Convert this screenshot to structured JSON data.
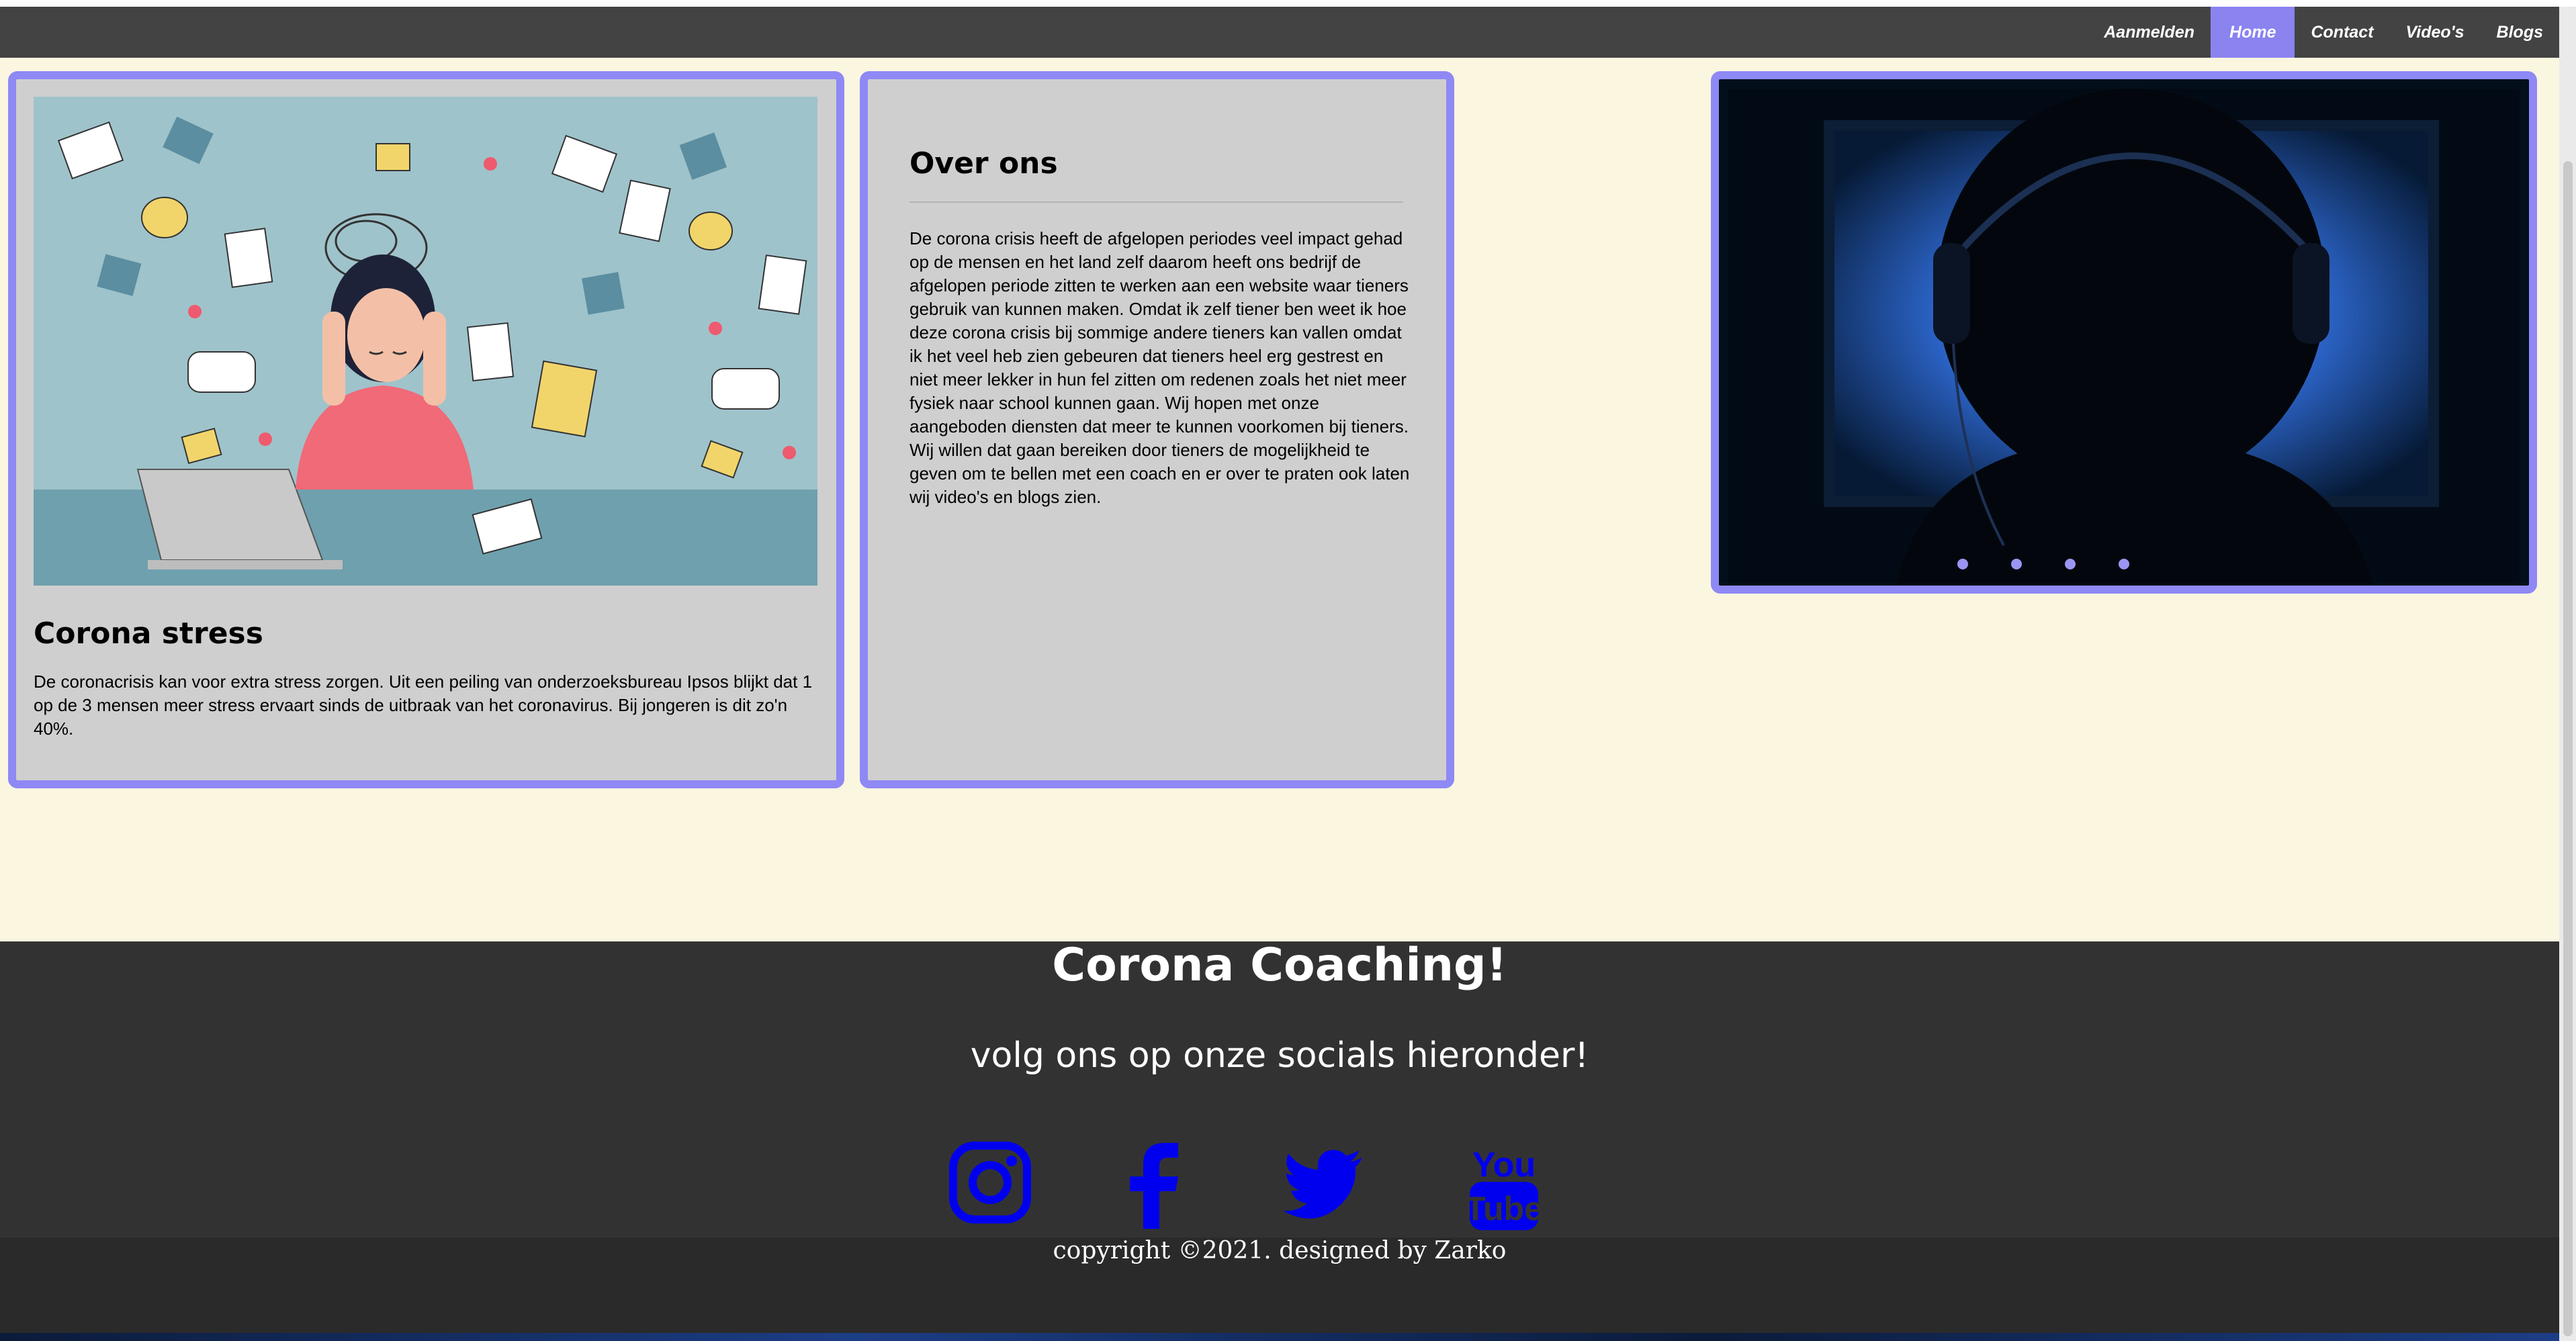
{
  "nav": {
    "items": [
      {
        "label": "Aanmelden",
        "active": false
      },
      {
        "label": "Home",
        "active": true
      },
      {
        "label": "Contact",
        "active": false
      },
      {
        "label": "Video's",
        "active": false
      },
      {
        "label": "Blogs",
        "active": false
      }
    ]
  },
  "cards": {
    "stress": {
      "image": "stressed-teen-illustration",
      "title": "Corona stress",
      "text": "De coronacrisis kan voor extra stress zorgen. Uit een peiling van onderzoeksbureau Ipsos blijkt dat 1 op de 3 mensen meer stress ervaart sinds de uitbraak van het coronavirus. Bij jongeren is dit zo'n 40%."
    },
    "about": {
      "title": "Over ons",
      "text": "De corona crisis heeft de afgelopen periodes veel impact gehad op de mensen en het land zelf daarom heeft ons bedrijf de afgelopen periode zitten te werken aan een website waar tieners gebruik van kunnen maken. Omdat ik zelf tiener ben weet ik hoe deze corona crisis bij sommige andere tieners kan vallen omdat ik het veel heb zien gebeuren dat tieners heel erg gestrest en niet meer lekker in hun fel zitten om redenen zoals het niet meer fysiek naar school kunnen gaan. Wij hopen met onze aangeboden diensten dat meer te kunnen voorkomen bij tieners. Wij willen dat gaan bereiken door tieners de mogelijkheid te geven om te bellen met een coach en er over te praten ook laten wij video's en blogs zien."
    },
    "slider": {
      "image": "silhouette-headphones-photo",
      "slide_count": 4
    }
  },
  "footer": {
    "title": "Corona Coaching!",
    "subtitle": "volg ons op onze socials hieronder!",
    "socials": [
      "instagram-icon",
      "facebook-icon",
      "twitter-icon",
      "youtube-icon"
    ],
    "social_color": "#0000ee",
    "copyright": "copyright ©2021. designed by Zarko"
  },
  "colors": {
    "accent": "#8e89f5",
    "nav_bg": "#444343",
    "page_bg": "#fbf6df",
    "card_bg": "#d0cfcf",
    "footer_bg": "#333233"
  }
}
